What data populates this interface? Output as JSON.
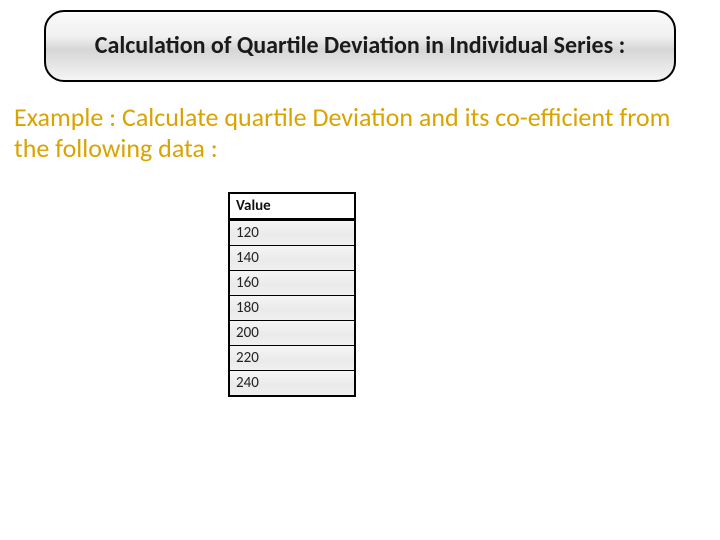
{
  "title": "Calculation of  Quartile Deviation in Individual Series :",
  "example_text": "Example : Calculate quartile Deviation and its co-efficient from the following data :",
  "table": {
    "header": "Value",
    "rows": [
      "120",
      "140",
      "160",
      "180",
      "200",
      "220",
      "240"
    ]
  },
  "chart_data": {
    "type": "table",
    "title": "Value",
    "categories": [
      "Value"
    ],
    "series": [
      {
        "name": "Value",
        "values": [
          120,
          140,
          160,
          180,
          200,
          220,
          240
        ]
      }
    ]
  }
}
